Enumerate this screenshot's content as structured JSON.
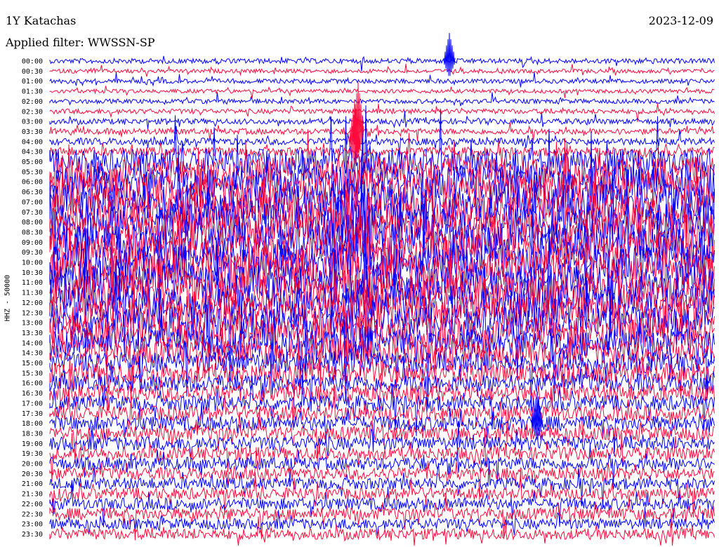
{
  "header": {
    "station": "1Y Katachas",
    "date": "2023-12-09",
    "filter_label": "Applied filter: WWSSN-SP"
  },
  "colors": {
    "trace_a": "#0000ff",
    "trace_b": "#ff0a3c",
    "text": "#000000",
    "background": "#ffffff"
  },
  "chart_data": {
    "type": "line",
    "title": "1Y Katachas",
    "ylabel": "HHZ - 50000",
    "row_labels": [
      "00:00",
      "00:30",
      "01:00",
      "01:30",
      "02:00",
      "02:30",
      "03:00",
      "03:30",
      "04:00",
      "04:30",
      "05:00",
      "05:30",
      "06:00",
      "06:30",
      "07:00",
      "07:30",
      "08:00",
      "08:30",
      "09:00",
      "09:30",
      "10:00",
      "10:30",
      "11:00",
      "11:30",
      "12:00",
      "12:30",
      "13:00",
      "13:30",
      "14:00",
      "14:30",
      "15:00",
      "15:30",
      "16:00",
      "16:30",
      "17:00",
      "17:30",
      "18:00",
      "18:30",
      "19:00",
      "19:30",
      "20:00",
      "20:30",
      "21:00",
      "21:30",
      "22:00",
      "22:30",
      "23:00",
      "23:30"
    ],
    "series": [
      {
        "color": "#0000ff",
        "rows": "even"
      },
      {
        "color": "#ff0a3c",
        "rows": "odd"
      }
    ],
    "grid": false,
    "legend": "none",
    "row_activity": [
      0.5,
      0.4,
      0.45,
      0.4,
      0.45,
      0.5,
      0.55,
      0.6,
      0.7,
      0.9,
      2.6,
      3.0,
      3.3,
      3.5,
      3.6,
      3.6,
      3.7,
      3.7,
      3.7,
      3.6,
      3.6,
      3.6,
      3.5,
      3.5,
      3.4,
      3.3,
      3.2,
      3.0,
      2.8,
      2.4,
      2.2,
      2.0,
      1.8,
      1.7,
      1.6,
      1.5,
      1.5,
      1.4,
      1.4,
      1.3,
      1.3,
      1.2,
      1.2,
      1.2,
      1.2,
      1.2,
      1.1,
      1.1
    ]
  }
}
